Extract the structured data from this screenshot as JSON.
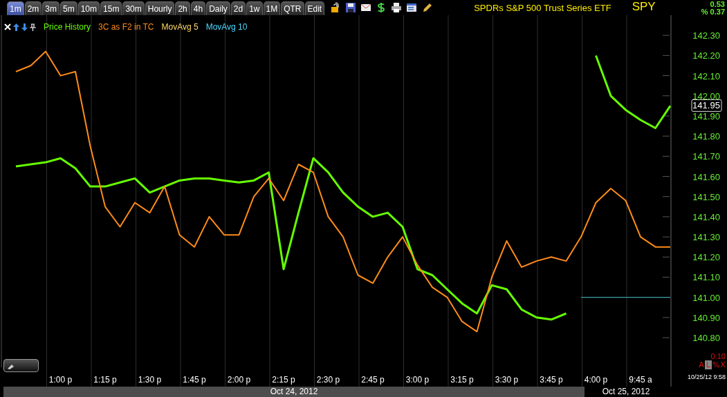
{
  "tabs": [
    {
      "label": "1m",
      "selected": true
    },
    {
      "label": "2m",
      "selected": false
    },
    {
      "label": "3m",
      "selected": false
    },
    {
      "label": "5m",
      "selected": false
    },
    {
      "label": "10m",
      "selected": false
    },
    {
      "label": "15m",
      "selected": false
    },
    {
      "label": "30m",
      "selected": false
    },
    {
      "label": "Hourly",
      "selected": false
    },
    {
      "label": "2h",
      "selected": false
    },
    {
      "label": "4h",
      "selected": false
    },
    {
      "label": "Daily",
      "selected": false
    },
    {
      "label": "2d",
      "selected": false
    },
    {
      "label": "1w",
      "selected": false
    },
    {
      "label": "1M",
      "selected": false
    },
    {
      "label": "QTR",
      "selected": false
    },
    {
      "label": "Edit",
      "selected": false
    }
  ],
  "security": {
    "name": "SPDRs S&P 500 Trust Series ETF",
    "symbol": "SPY",
    "change": "0.53",
    "change_percent": "% 0.37"
  },
  "chart": {
    "legend": [
      {
        "label": "Price History",
        "color": "#66ff00"
      },
      {
        "label": "3C as F2 in TC",
        "color": "#ff8c1a"
      },
      {
        "label": "MovAvg 5",
        "color": "#ffd966"
      },
      {
        "label": "MovAvg 10",
        "color": "#4dd9ff"
      }
    ],
    "last_price": "141.95",
    "scale_value": "0.10",
    "scale_buttons": [
      "A",
      "L",
      "%",
      "X"
    ],
    "timestamp": "10/25/12 9:58",
    "dates": [
      "Oct 24, 2012",
      "Oct 25, 2012"
    ],
    "chart_data": {
      "type": "line",
      "grid": true,
      "ylim": [
        140.55,
        142.4
      ],
      "categories": [
        null,
        null,
        null,
        "1:00 p",
        null,
        null,
        "1:15 p",
        null,
        null,
        "1:30 p",
        null,
        null,
        "1:45 p",
        null,
        null,
        "2:00 p",
        null,
        null,
        "2:15 p",
        null,
        null,
        "2:30 p",
        null,
        null,
        "2:45 p",
        null,
        null,
        "3:00 p",
        null,
        null,
        "3:15 p",
        null,
        null,
        "3:30 p",
        null,
        null,
        "3:45 p",
        null,
        null,
        "4:00 p",
        null,
        null,
        "9:45 a",
        null,
        null
      ],
      "series": [
        {
          "color": "#66ff00",
          "values": [
            141.65,
            141.66,
            141.67,
            141.69,
            141.64,
            141.55,
            141.55,
            141.57,
            141.59,
            141.52,
            141.55,
            141.58,
            141.59,
            141.59,
            141.58,
            141.57,
            141.58,
            141.62,
            141.14,
            141.42,
            141.69,
            141.62,
            141.52,
            141.45,
            141.4,
            141.42,
            141.35,
            141.14,
            141.11,
            141.04,
            140.97,
            140.92,
            141.06,
            141.04,
            140.94,
            140.9,
            140.89,
            140.92,
            null,
            142.2,
            142.0,
            141.93,
            141.88,
            141.84,
            141.95
          ]
        },
        {
          "color": "#ff8c1a",
          "values": [
            142.12,
            142.15,
            142.22,
            142.1,
            142.12,
            141.75,
            141.45,
            141.35,
            141.47,
            141.42,
            141.55,
            141.31,
            141.25,
            141.4,
            141.31,
            141.31,
            141.5,
            141.59,
            141.48,
            141.66,
            141.62,
            141.4,
            141.3,
            141.11,
            141.07,
            141.2,
            141.3,
            141.16,
            141.05,
            141.0,
            140.88,
            140.83,
            141.1,
            141.28,
            141.15,
            141.18,
            141.2,
            141.18,
            141.3,
            141.47,
            141.54,
            141.48,
            141.3,
            141.25,
            141.25
          ]
        },
        {
          "color": "#3aa0a8",
          "values": [
            null,
            null,
            null,
            null,
            null,
            null,
            null,
            null,
            null,
            null,
            null,
            null,
            null,
            null,
            null,
            null,
            null,
            null,
            null,
            null,
            null,
            null,
            null,
            null,
            null,
            null,
            null,
            null,
            null,
            null,
            null,
            null,
            null,
            null,
            null,
            null,
            null,
            null,
            141.0,
            141.0,
            141.0,
            141.0,
            141.0,
            141.0,
            141.0
          ]
        }
      ],
      "yticks": [
        {
          "value": 142.3,
          "label": "142.30"
        },
        {
          "value": 142.2,
          "label": "142.20"
        },
        {
          "value": 142.1,
          "label": "142.10"
        },
        {
          "value": 142.0,
          "label": "142.00"
        },
        {
          "value": 141.9,
          "label": "141.90"
        },
        {
          "value": 141.8,
          "label": "141.80"
        },
        {
          "value": 141.7,
          "label": "141.70"
        },
        {
          "value": 141.6,
          "label": "141.60"
        },
        {
          "value": 141.5,
          "label": "141.50"
        },
        {
          "value": 141.4,
          "label": "141.40"
        },
        {
          "value": 141.3,
          "label": "141.30"
        },
        {
          "value": 141.2,
          "label": "141.20"
        },
        {
          "value": 141.1,
          "label": "141.10"
        },
        {
          "value": 141.0,
          "label": "141.00"
        },
        {
          "value": 140.9,
          "label": "140.90"
        },
        {
          "value": 140.8,
          "label": "140.80"
        }
      ]
    }
  }
}
